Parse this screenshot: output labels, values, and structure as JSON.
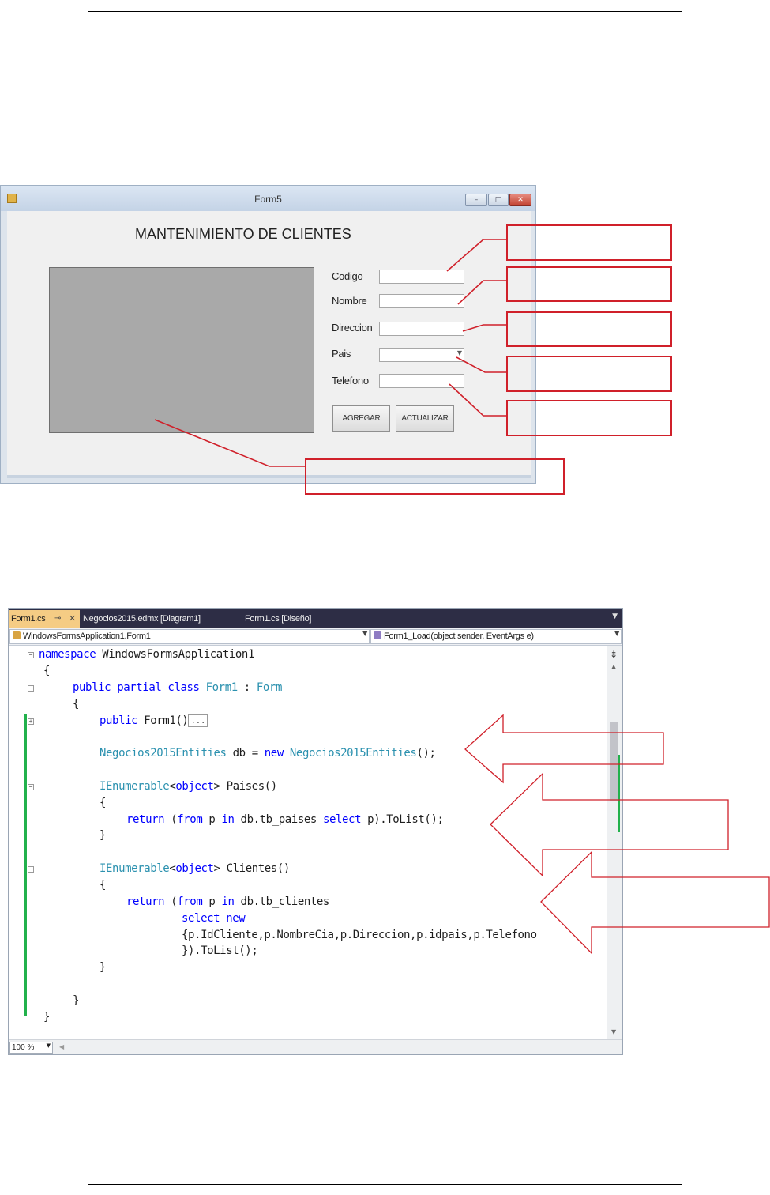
{
  "form": {
    "window_title": "Form5",
    "heading": "MANTENIMIENTO DE CLIENTES",
    "labels": {
      "codigo": "Codigo",
      "nombre": "Nombre",
      "direccion": "Direccion",
      "pais": "Pais",
      "telefono": "Telefono"
    },
    "buttons": {
      "agregar": "AGREGAR",
      "actualizar": "ACTUALIZAR"
    }
  },
  "editor": {
    "tabs": [
      {
        "label": "Form1.cs"
      },
      {
        "label": "Negocios2015.edmx [Diagram1]"
      },
      {
        "label": "Form1.cs [Diseño]"
      }
    ],
    "nav_left": "WindowsFormsApplication1.Form1",
    "nav_right": "Form1_Load(object sender, EventArgs e)",
    "zoom": "100 %",
    "code": {
      "l1_kw": "namespace",
      "l1_rest": " WindowsFormsApplication1",
      "l2": "{",
      "l3_kw": "public partial class",
      "l3_type": "Form1",
      "l3_colon": " : ",
      "l3_base": "Form",
      "l4": "{",
      "l5_kw": "public",
      "l5_rest": " Form1()",
      "l5_collapsed": "...",
      "l6_type": "Negocios2015Entities",
      "l6_mid": " db = ",
      "l6_kw": "new",
      "l6_type2": "Negocios2015Entities",
      "l6_end": "();",
      "l7_type": "IEnumerable",
      "l7_lt": "<",
      "l7_kw": "object",
      "l7_rest": "> Paises()",
      "l8": "{",
      "l9_kw1": "return",
      "l9_p1": " (",
      "l9_kw2": "from",
      "l9_p2": " p ",
      "l9_kw3": "in",
      "l9_p3": " db.tb_paises ",
      "l9_kw4": "select",
      "l9_p4": " p).ToList();",
      "l10": "}",
      "l11_type": "IEnumerable",
      "l11_lt": "<",
      "l11_kw": "object",
      "l11_rest": "> Clientes()",
      "l12": "{",
      "l13_kw1": "return",
      "l13_p1": " (",
      "l13_kw2": "from",
      "l13_p2": " p ",
      "l13_kw3": "in",
      "l13_p3": " db.tb_clientes",
      "l14_kw1": "select",
      "l14_kw2": "new",
      "l15": "{p.IdCliente,p.NombreCia,p.Direccion,p.idpais,p.Telefono",
      "l16": "}).ToList();",
      "l17": "}",
      "l18": "}",
      "l19": "}"
    }
  },
  "colors": {
    "callout_red": "#d0202a",
    "keyword_blue": "#0000ff",
    "type_teal": "#2b91af",
    "change_green": "#22b14c",
    "tab_active": "#f5cc84"
  }
}
